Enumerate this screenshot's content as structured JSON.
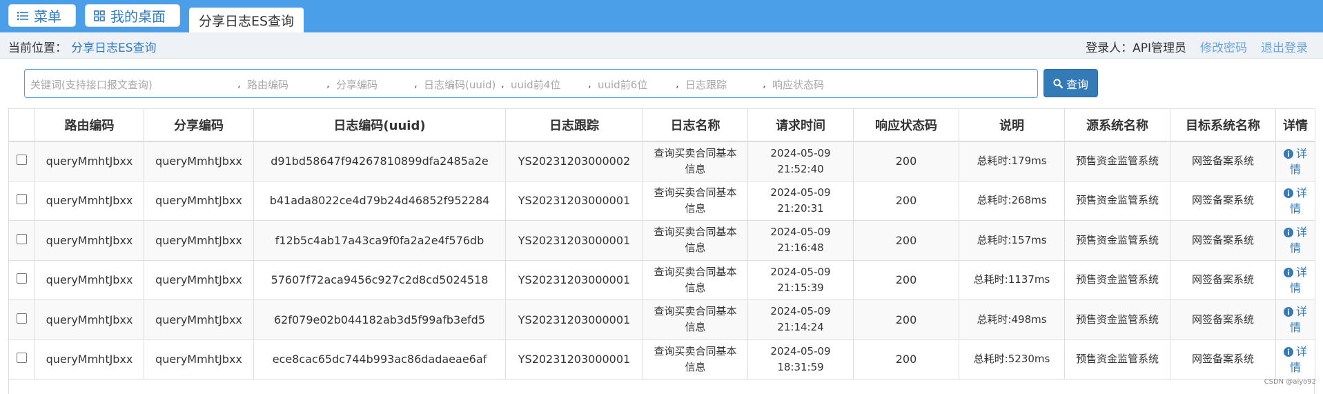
{
  "topbar": {
    "menu_label": "菜单",
    "desktop_label": "我的桌面",
    "active_tab": "分享日志ES查询",
    "color": "#4a9fe8"
  },
  "breadcrumb": {
    "prefix": "当前位置：",
    "current": "分享日志ES查询"
  },
  "user": {
    "login_label": "登录人：API管理员",
    "change_password": "修改密码",
    "logout": "退出登录"
  },
  "search": {
    "placeholders": [
      "关键词(支持接口报文查询)",
      "路由编码",
      "分享编码",
      "日志编码(uuid)",
      "uuid前4位",
      "uuid前6位",
      "日志跟踪",
      "响应状态码"
    ],
    "separator": ",",
    "button_label": "查询",
    "icon": "search-icon"
  },
  "table": {
    "headers": [
      "",
      "路由编码",
      "分享编码",
      "日志编码(uuid)",
      "日志跟踪",
      "日志名称",
      "请求时间",
      "响应状态码",
      "说明",
      "源系统名称",
      "目标系统名称",
      "详情"
    ],
    "detail_label_1": "详",
    "detail_label_2": "情",
    "rows": [
      {
        "route": "queryMmhtJbxx",
        "share": "queryMmhtJbxx",
        "uuid": "d91bd58647f94267810899dfa2485a2e",
        "trace": "YS20231203000002",
        "name_1": "查询买卖合同基本",
        "name_2": "信息",
        "date": "2024-05-09",
        "time": "21:52:40",
        "status": "200",
        "desc": "总耗时:179ms",
        "source": "预售资金监管系统",
        "target": "网签备案系统"
      },
      {
        "route": "queryMmhtJbxx",
        "share": "queryMmhtJbxx",
        "uuid": "b41ada8022ce4d79b24d46852f952284",
        "trace": "YS20231203000001",
        "name_1": "查询买卖合同基本",
        "name_2": "信息",
        "date": "2024-05-09",
        "time": "21:20:31",
        "status": "200",
        "desc": "总耗时:268ms",
        "source": "预售资金监管系统",
        "target": "网签备案系统"
      },
      {
        "route": "queryMmhtJbxx",
        "share": "queryMmhtJbxx",
        "uuid": "f12b5c4ab17a43ca9f0fa2a2e4f576db",
        "trace": "YS20231203000001",
        "name_1": "查询买卖合同基本",
        "name_2": "信息",
        "date": "2024-05-09",
        "time": "21:16:48",
        "status": "200",
        "desc": "总耗时:157ms",
        "source": "预售资金监管系统",
        "target": "网签备案系统"
      },
      {
        "route": "queryMmhtJbxx",
        "share": "queryMmhtJbxx",
        "uuid": "57607f72aca9456c927c2d8cd5024518",
        "trace": "YS20231203000001",
        "name_1": "查询买卖合同基本",
        "name_2": "信息",
        "date": "2024-05-09",
        "time": "21:15:39",
        "status": "200",
        "desc": "总耗时:1137ms",
        "source": "预售资金监管系统",
        "target": "网签备案系统"
      },
      {
        "route": "queryMmhtJbxx",
        "share": "queryMmhtJbxx",
        "uuid": "62f079e02b044182ab3d5f99afb3efd5",
        "trace": "YS20231203000001",
        "name_1": "查询买卖合同基本",
        "name_2": "信息",
        "date": "2024-05-09",
        "time": "21:14:24",
        "status": "200",
        "desc": "总耗时:498ms",
        "source": "预售资金监管系统",
        "target": "网签备案系统"
      },
      {
        "route": "queryMmhtJbxx",
        "share": "queryMmhtJbxx",
        "uuid": "ece8cac65dc744b993ac86dadaeae6af",
        "trace": "YS20231203000001",
        "name_1": "查询买卖合同基本",
        "name_2": "信息",
        "date": "2024-05-09",
        "time": "18:31:59",
        "status": "200",
        "desc": "总耗时:5230ms",
        "source": "预售资金监管系统",
        "target": "网签备案系统"
      }
    ]
  },
  "watermark": "CSDN @aiyo92"
}
